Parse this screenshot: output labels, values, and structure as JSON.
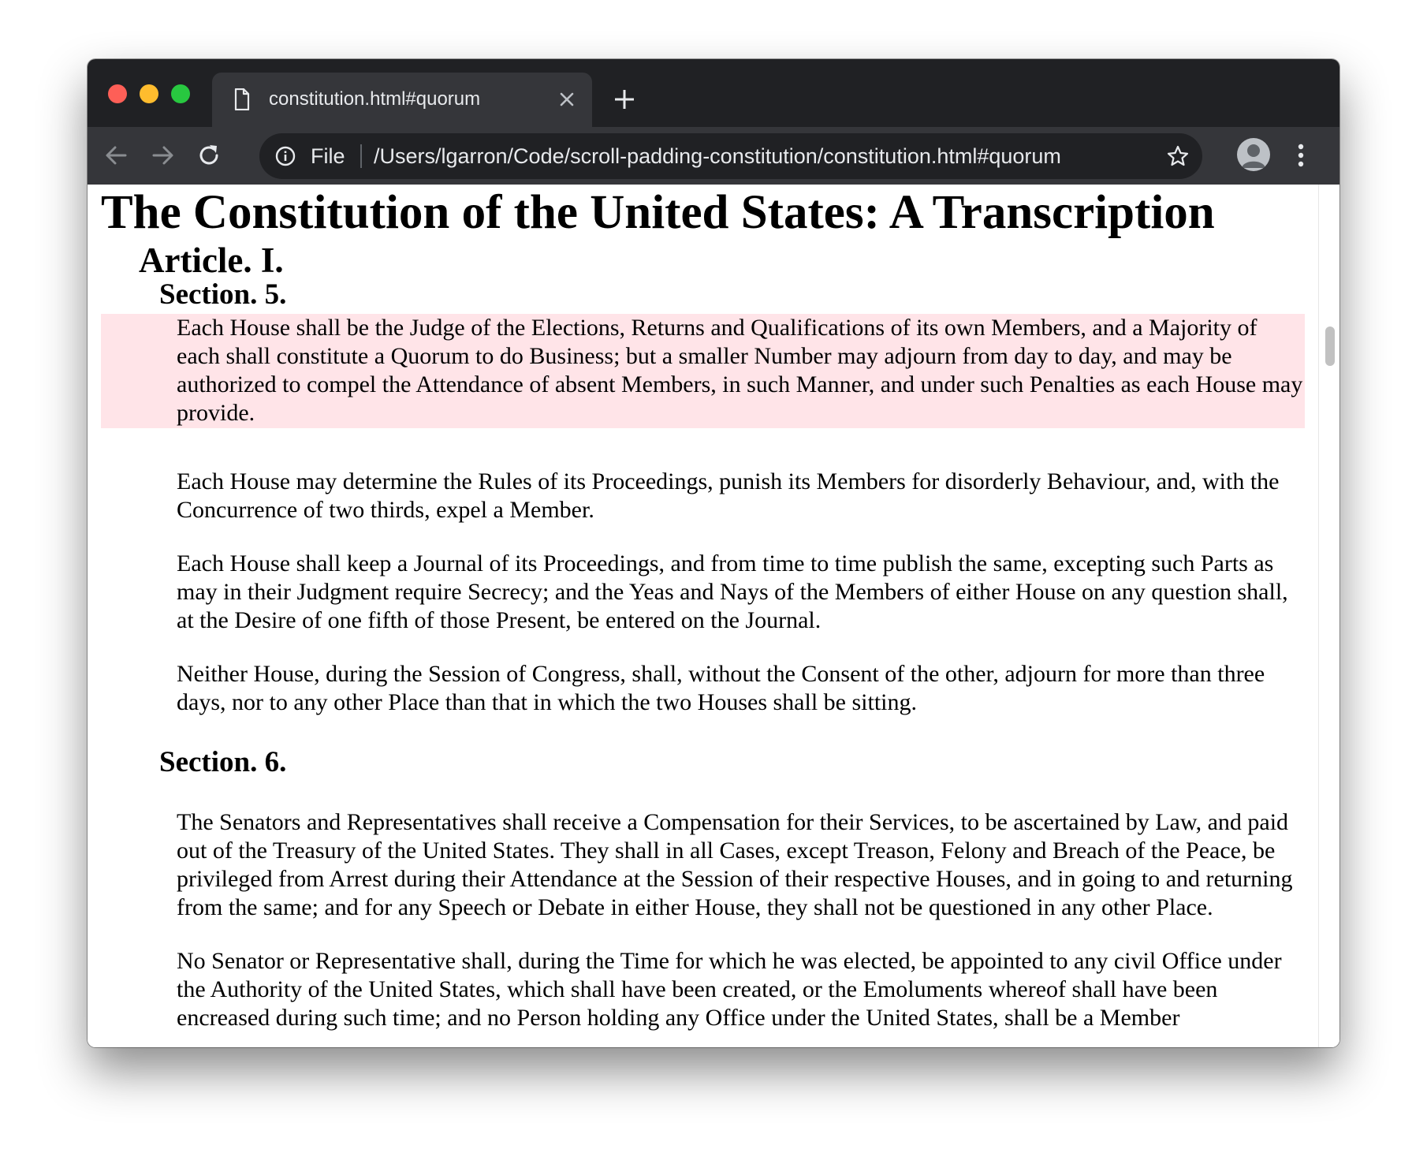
{
  "browser": {
    "tab": {
      "title": "constitution.html#quorum",
      "icon": "file-icon"
    },
    "toolbar": {
      "scheme_label": "File",
      "url": "/Users/lgarron/Code/scroll-padding-constitution/constitution.html#quorum"
    },
    "colors": {
      "tabstrip": "#202124",
      "toolbar": "#35363a",
      "highlight": "#ffe4e8"
    }
  },
  "document": {
    "title": "The Constitution of the United States: A Transcription",
    "article": "Article. I.",
    "sections": [
      {
        "heading": "Section. 5.",
        "paragraphs": [
          "Each House shall be the Judge of the Elections, Returns and Qualifications of its own Members, and a Majority of each shall constitute a Quorum to do Business; but a smaller Number may adjourn from day to day, and may be authorized to compel the Attendance of absent Members, in such Manner, and under such Penalties as each House may provide.",
          "Each House may determine the Rules of its Proceedings, punish its Members for disorderly Behaviour, and, with the Concurrence of two thirds, expel a Member.",
          "Each House shall keep a Journal of its Proceedings, and from time to time publish the same, excepting such Parts as may in their Judgment require Secrecy; and the Yeas and Nays of the Members of either House on any question shall, at the Desire of one fifth of those Present, be entered on the Journal.",
          "Neither House, during the Session of Congress, shall, without the Consent of the other, adjourn for more than three days, nor to any other Place than that in which the two Houses shall be sitting."
        ]
      },
      {
        "heading": "Section. 6.",
        "paragraphs": [
          "The Senators and Representatives shall receive a Compensation for their Services, to be ascertained by Law, and paid out of the Treasury of the United States. They shall in all Cases, except Treason, Felony and Breach of the Peace, be privileged from Arrest during their Attendance at the Session of their respective Houses, and in going to and returning from the same; and for any Speech or Debate in either House, they shall not be questioned in any other Place.",
          "No Senator or Representative shall, during the Time for which he was elected, be appointed to any civil Office under the Authority of the United States, which shall have been created, or the Emoluments whereof shall have been encreased during such time; and no Person holding any Office under the United States, shall be a Member"
        ]
      }
    ]
  }
}
